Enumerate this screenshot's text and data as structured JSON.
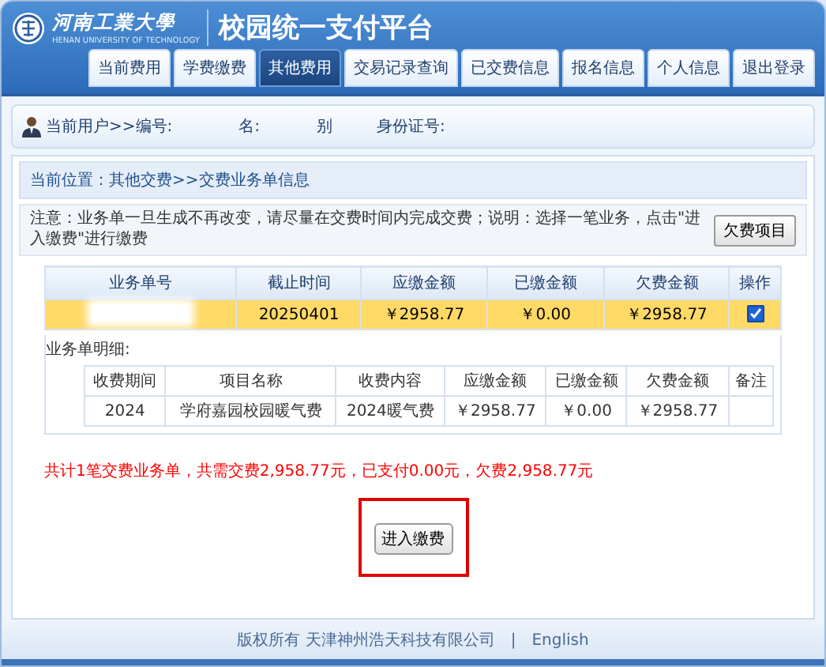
{
  "header": {
    "logo_name": "河南工業大學",
    "logo_subtitle": "HENAN UNIVERSITY OF TECHNOLOGY",
    "title": "校园统一支付平台"
  },
  "nav_tabs": [
    {
      "label": "当前费用",
      "selected": false
    },
    {
      "label": "学费缴费",
      "selected": false
    },
    {
      "label": "其他费用",
      "selected": true
    },
    {
      "label": "交易记录查询",
      "selected": false
    },
    {
      "label": "已交费信息",
      "selected": false
    },
    {
      "label": "报名信息",
      "selected": false
    },
    {
      "label": "个人信息",
      "selected": false
    },
    {
      "label": "退出登录",
      "selected": false
    }
  ],
  "user_bar": {
    "labels": [
      "当前用户>>编号:",
      "名:",
      "别",
      "身份证号:"
    ]
  },
  "breadcrumb": "当前位置：其他交费>>交费业务单信息",
  "notice": {
    "text": "注意：业务单一旦生成不再改变，请尽量在交费时间内完成交费；说明：选择一笔业务，点击\"进入缴费\"进行缴费",
    "button": "欠费项目"
  },
  "orders_table": {
    "columns": [
      "业务单号",
      "截止时间",
      "应缴金额",
      "已缴金额",
      "欠费金额",
      "操作"
    ],
    "rows": [
      {
        "cells": [
          "",
          "20250401",
          "￥2958.77",
          "￥0.00",
          "￥2958.77"
        ],
        "checked": true,
        "selected": true
      }
    ]
  },
  "detail_label": "业务单明细:",
  "detail_table": {
    "columns": [
      "收费期间",
      "项目名称",
      "收费内容",
      "应缴金额",
      "已缴金额",
      "欠费金额",
      "备注"
    ],
    "rows": [
      {
        "cells": [
          "2024",
          "学府嘉园校园暖气费",
          "2024暖气费",
          "￥2958.77",
          "￥0.00",
          "￥2958.77"
        ]
      }
    ]
  },
  "summary": "共计1笔交费业务单，共需交费2,958.77元，已支付0.00元，欠费2,958.77元",
  "action_button": "进入缴费",
  "footer": {
    "copyright": "版权所有 天津神州浩天科技有限公司",
    "separator": "|",
    "language_link": "English"
  }
}
